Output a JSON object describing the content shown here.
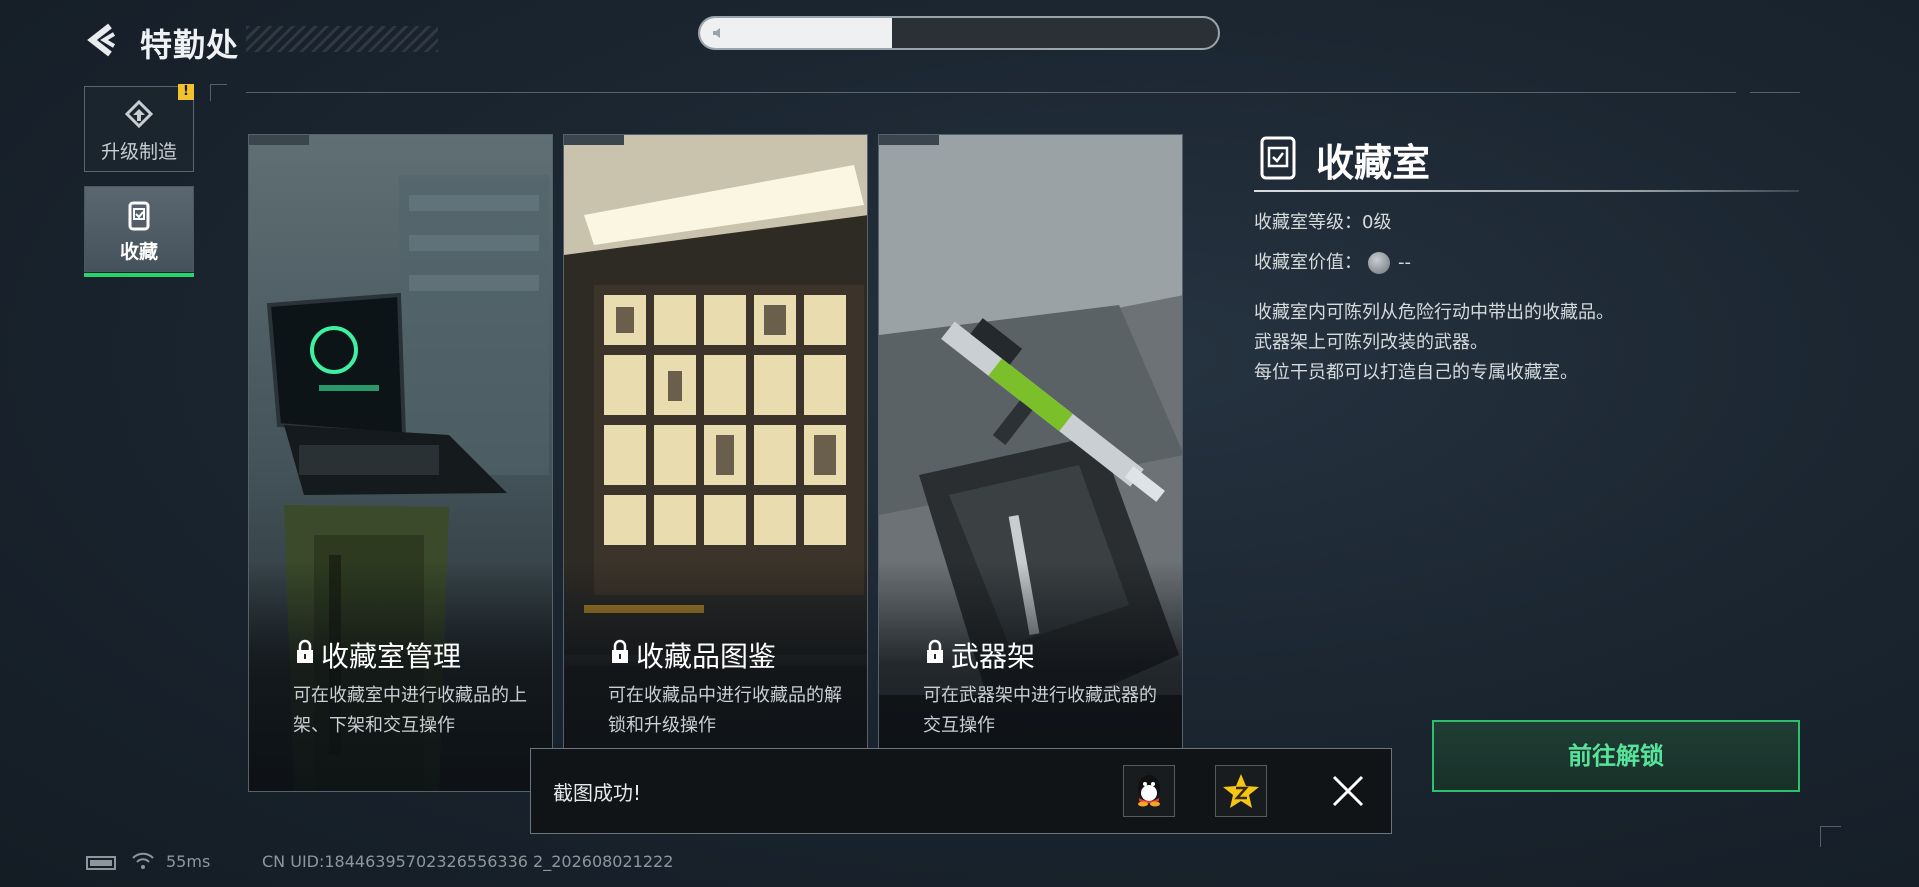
{
  "header": {
    "title": "特勤处"
  },
  "top_progress": {
    "fraction": 0.37
  },
  "sidebar": {
    "items": [
      {
        "label": "升级制造",
        "icon": "upgrade-icon",
        "badge": "!"
      },
      {
        "label": "收藏",
        "icon": "collection-icon",
        "active": true
      }
    ]
  },
  "cards": [
    {
      "title": "收藏室管理",
      "desc": "可在收藏室中进行收藏品的上架、下架和交互操作",
      "locked": true
    },
    {
      "title": "收藏品图鉴",
      "desc": "可在收藏品中进行收藏品的解锁和升级操作",
      "locked": true
    },
    {
      "title": "武器架",
      "desc": "可在武器架中进行收藏武器的交互操作",
      "locked": true
    }
  ],
  "panel": {
    "title": "收藏室",
    "level": "收藏室等级：0级",
    "value_label": "收藏室价值：",
    "value": "--",
    "desc1": "收藏室内可陈列从危险行动中带出的收藏品。",
    "desc2": "武器架上可陈列改装的武器。",
    "desc3": "每位干员都可以打造自己的专属收藏室。",
    "unlock_button": "前往解锁"
  },
  "toast": {
    "text": "截图成功!"
  },
  "status": {
    "ping": "55ms",
    "uid": "CN UID:18446395702326556336 2_202608021222"
  },
  "colors": {
    "accent_green": "#2fbf6a",
    "badge_yellow": "#f2c12e"
  }
}
